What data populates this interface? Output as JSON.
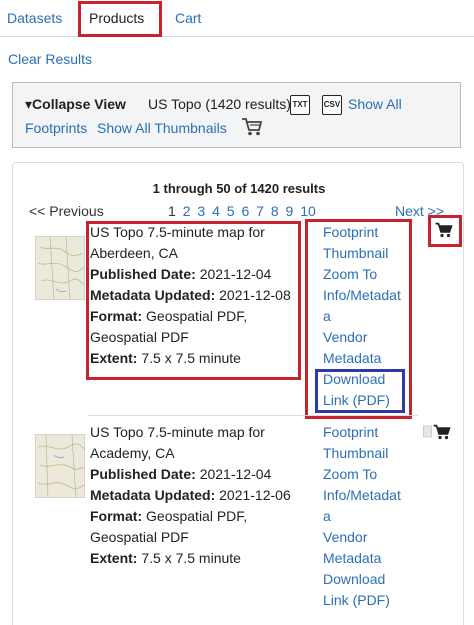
{
  "tabs": [
    {
      "label": "Datasets"
    },
    {
      "label": "Products"
    },
    {
      "label": "Cart"
    }
  ],
  "clear_results": "Clear Results",
  "panel": {
    "collapse_label": "▾Collapse View",
    "summary": "US Topo (1420 results)",
    "txt_icon": "TXT",
    "csv_icon": "CSV",
    "show_all_footprints_line1": "Show All",
    "show_all_footprints_line2": "Footprints",
    "show_all_thumbnails": "Show All Thumbnails"
  },
  "results": {
    "count_text": "1 through 50 of 1420 results",
    "previous": "<< Previous",
    "current_page": "1",
    "pages": [
      "2",
      "3",
      "4",
      "5",
      "6",
      "7",
      "8",
      "9",
      "10"
    ],
    "next": "Next >>"
  },
  "items": [
    {
      "title": "US Topo 7.5-minute map for Aberdeen, CA",
      "published_label": "Published Date:",
      "published_value": "2021-12-04",
      "metadata_label": "Metadata Updated:",
      "metadata_value": "2021-12-08",
      "format_label": "Format:",
      "format_value": "Geospatial PDF, Geospatial PDF",
      "extent_label": "Extent:",
      "extent_value": "7.5 x 7.5 minute",
      "links": {
        "footprint": "Footprint",
        "thumbnail": "Thumbnail",
        "zoom_to": "Zoom To",
        "info_a": "Info/Metadat",
        "info_b": "a",
        "vendor_a": "Vendor",
        "vendor_b": "Metadata",
        "download_a": "Download",
        "download_b": "Link (PDF)"
      }
    },
    {
      "title": "US Topo 7.5-minute map for Academy, CA",
      "published_label": "Published Date:",
      "published_value": "2021-12-04",
      "metadata_label": "Metadata Updated:",
      "metadata_value": "2021-12-06",
      "format_label": "Format:",
      "format_value": "Geospatial PDF, Geospatial PDF",
      "extent_label": "Extent:",
      "extent_value": "7.5 x 7.5 minute",
      "links": {
        "footprint": "Footprint",
        "thumbnail": "Thumbnail",
        "zoom_to": "Zoom To",
        "info_a": "Info/Metadat",
        "info_b": "a",
        "vendor_a": "Vendor",
        "vendor_b": "Metadata",
        "download_a": "Download",
        "download_b": "Link (PDF)"
      }
    }
  ],
  "colors": {
    "link": "#2b6fb6",
    "highlight_red": "#c8232c",
    "highlight_blue": "#2d3aa6",
    "panel_bg": "#f3f4f6"
  },
  "icons": [
    "cart-icon",
    "txt-file-icon",
    "csv-file-icon",
    "map-thumbnail"
  ]
}
